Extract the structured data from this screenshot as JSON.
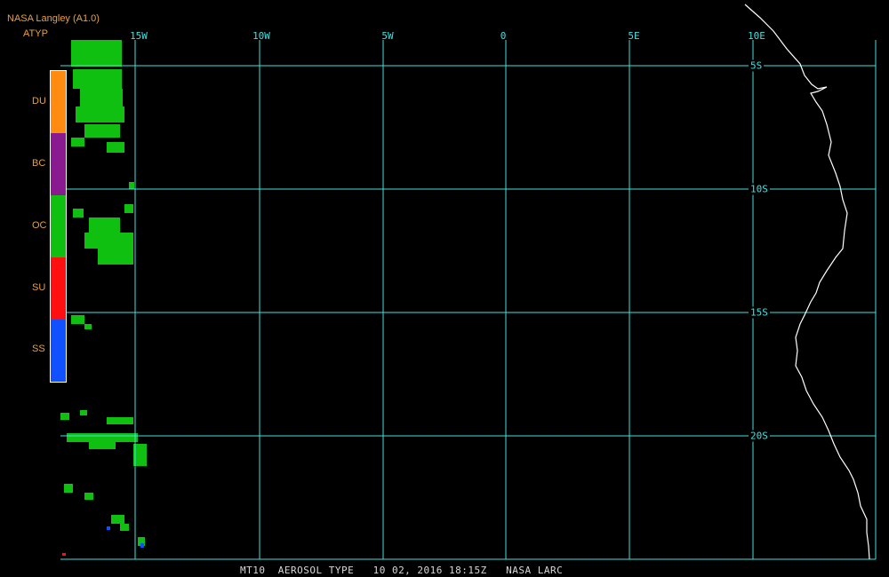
{
  "header": {
    "title": "NASA Langley (A1.0)",
    "product": "ATYP"
  },
  "longitude_labels": [
    "15W",
    "10W",
    "5W",
    "0",
    "5E",
    "10E"
  ],
  "latitude_labels": [
    "5S",
    "10S",
    "15S",
    "20S"
  ],
  "legend": [
    {
      "label": "DU",
      "color": "#ff8c10"
    },
    {
      "label": "BC",
      "color": "#8a1a90"
    },
    {
      "label": "OC",
      "color": "#10c010"
    },
    {
      "label": "SU",
      "color": "#ff1010"
    },
    {
      "label": "SS",
      "color": "#1050ff"
    }
  ],
  "footer": "MT10  AEROSOL TYPE   10 02, 2016 18:15Z   NASA LARC",
  "colors": {
    "grid": "#40e0e0",
    "coast": "#ffffff",
    "label": "#e8a040"
  }
}
